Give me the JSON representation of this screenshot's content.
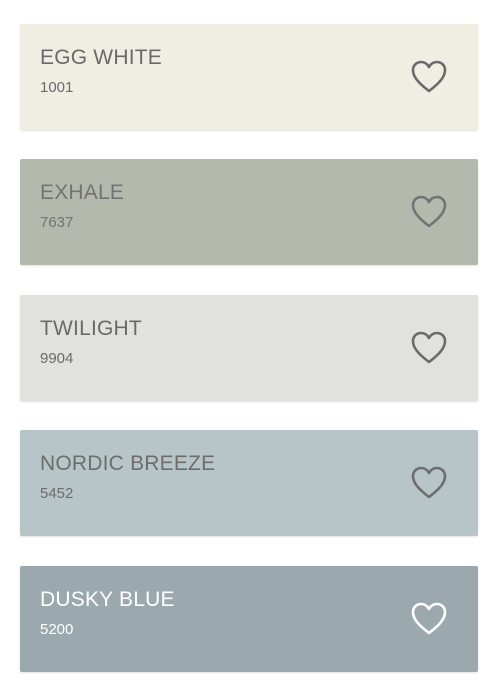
{
  "colors": [
    {
      "name": "EGG WHITE",
      "code": "1001",
      "bg": "#f0ede2",
      "text": "#6a6a6a",
      "icon": "heart-outline-icon"
    },
    {
      "name": "EXHALE",
      "code": "7637",
      "bg": "#b4b9ad",
      "text": "#737373",
      "icon": "heart-outline-icon"
    },
    {
      "name": "TWILIGHT",
      "code": "9904",
      "bg": "#e1e1df",
      "text": "#6a6a6a",
      "icon": "heart-outline-icon"
    },
    {
      "name": "NORDIC BREEZE",
      "code": "5452",
      "bg": "#b8c5c8",
      "text": "#6d6d6d",
      "icon": "heart-outline-icon"
    },
    {
      "name": "DUSKY BLUE",
      "code": "5200",
      "bg": "#9ba9ae",
      "text": "#ffffff",
      "icon": "heart-outline-icon"
    }
  ]
}
